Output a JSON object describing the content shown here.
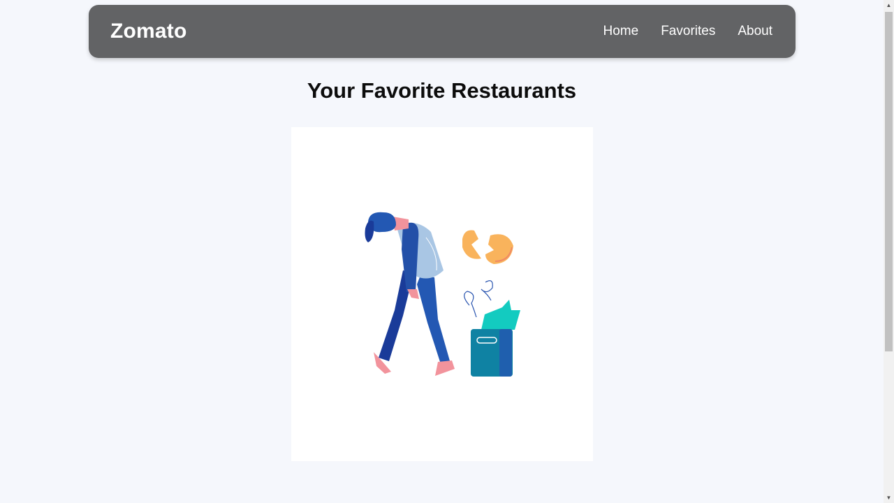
{
  "navbar": {
    "brand": "Zomato",
    "links": [
      {
        "label": "Home"
      },
      {
        "label": "Favorites"
      },
      {
        "label": "About"
      }
    ]
  },
  "main": {
    "title": "Your Favorite Restaurants",
    "illustration_icon": "sad-person-broken-egg-trash-illustration"
  },
  "colors": {
    "navbar_bg": "#626365",
    "page_bg": "#f5f7fc",
    "card_bg": "#ffffff"
  }
}
